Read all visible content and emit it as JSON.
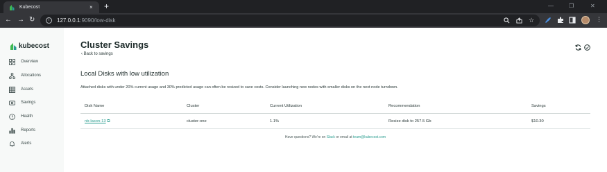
{
  "browser": {
    "tab_title": "Kubecost",
    "tab_close": "×",
    "new_tab": "+",
    "url_host": "127.0.0.1",
    "url_path": ":9090/low-disk",
    "window_controls": [
      "—",
      "❐",
      "✕"
    ]
  },
  "sidebar": {
    "logo_text": "kubecost",
    "items": [
      {
        "label": "Overview",
        "icon": "grid-icon"
      },
      {
        "label": "Allocations",
        "icon": "nodes-icon"
      },
      {
        "label": "Assets",
        "icon": "table-icon"
      },
      {
        "label": "Savings",
        "icon": "savings-icon"
      },
      {
        "label": "Health",
        "icon": "info-circle-icon"
      },
      {
        "label": "Reports",
        "icon": "bar-chart-icon"
      },
      {
        "label": "Alerts",
        "icon": "bell-icon"
      }
    ]
  },
  "header": {
    "title": "Cluster Savings",
    "back_link": "Back to savings"
  },
  "section": {
    "title": "Local Disks with low utilization",
    "description": "Attached disks with under 20% current usage and 30% predicted usage can often be resized to save costs. Consider launching new nodes with smaller disks on the next node turndown."
  },
  "table": {
    "columns": [
      "Disk Name",
      "Cluster",
      "Current Utilization",
      "Recommendation",
      "Savings"
    ],
    "rows": [
      {
        "disk_name": "nb-lason-13",
        "cluster": "cluster-one",
        "utilization": "1.1%",
        "recommendation": "Resize disk to 257.5 Gb",
        "savings": "$10.30"
      }
    ]
  },
  "footer": {
    "prefix": "Have questions? We're on",
    "slack": "Slack",
    "middle": "or email at",
    "email": "team@kubecost.com"
  },
  "colors": {
    "accent": "#2a9d8f",
    "sidebar_bg": "#f7f9f8",
    "chrome_dark": "#202124",
    "chrome_toolbar": "#35363a"
  }
}
